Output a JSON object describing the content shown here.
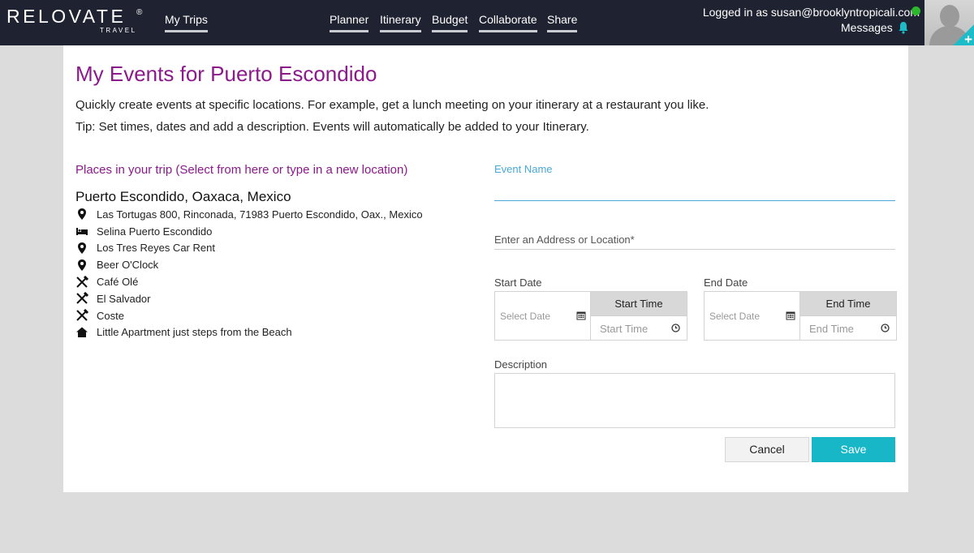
{
  "header": {
    "logo_text": "RELOVATE",
    "logo_reg": "®",
    "logo_sub": "TRAVEL",
    "my_trips": "My Trips",
    "nav": {
      "planner": "Planner",
      "itinerary": "Itinerary",
      "budget": "Budget",
      "collaborate": "Collaborate",
      "share": "Share"
    },
    "login_text": "Logged in as susan@brooklyntropicali.com",
    "messages": "Messages",
    "avatar_plus": "+",
    "colors": {
      "bar": "#1f2230",
      "status": "#2eb82e",
      "accent": "#1dbcc9"
    }
  },
  "page": {
    "title": "My Events for Puerto Escondido",
    "intro1": "Quickly create events at specific locations. For example, get a lunch meeting on your itinerary at a restaurant you like.",
    "intro2": "Tip: Set times, dates and add a description. Events will automatically be added to your Itinerary.",
    "title_color": "#8b1a8b"
  },
  "places": {
    "heading": "Places in your trip (Select from here or type in a new location)",
    "city": "Puerto Escondido, Oaxaca, Mexico",
    "items": [
      {
        "icon": "map-pin-icon",
        "label": "Las Tortugas 800, Rinconada, 71983 Puerto Escondido, Oax., Mexico"
      },
      {
        "icon": "bed-icon",
        "label": "Selina Puerto Escondido"
      },
      {
        "icon": "map-pin-icon",
        "label": "Los Tres Reyes Car Rent"
      },
      {
        "icon": "map-pin-icon",
        "label": "Beer O'Clock"
      },
      {
        "icon": "utensils-icon",
        "label": "Café Olé"
      },
      {
        "icon": "utensils-icon",
        "label": "El Salvador"
      },
      {
        "icon": "utensils-icon",
        "label": "Coste"
      },
      {
        "icon": "home-icon",
        "label": "Little Apartment just steps from the Beach"
      }
    ]
  },
  "form": {
    "event_name_label": "Event Name",
    "event_name_value": "",
    "address_placeholder": "Enter an Address or Location*",
    "start_date_label": "Start Date",
    "end_date_label": "End Date",
    "date_placeholder": "Select Date",
    "start_time_header": "Start Time",
    "start_time_placeholder": "Start Time",
    "end_time_header": "End Time",
    "end_time_placeholder": "End Time",
    "description_label": "Description",
    "cancel": "Cancel",
    "save": "Save",
    "save_color": "#18b7c8"
  }
}
